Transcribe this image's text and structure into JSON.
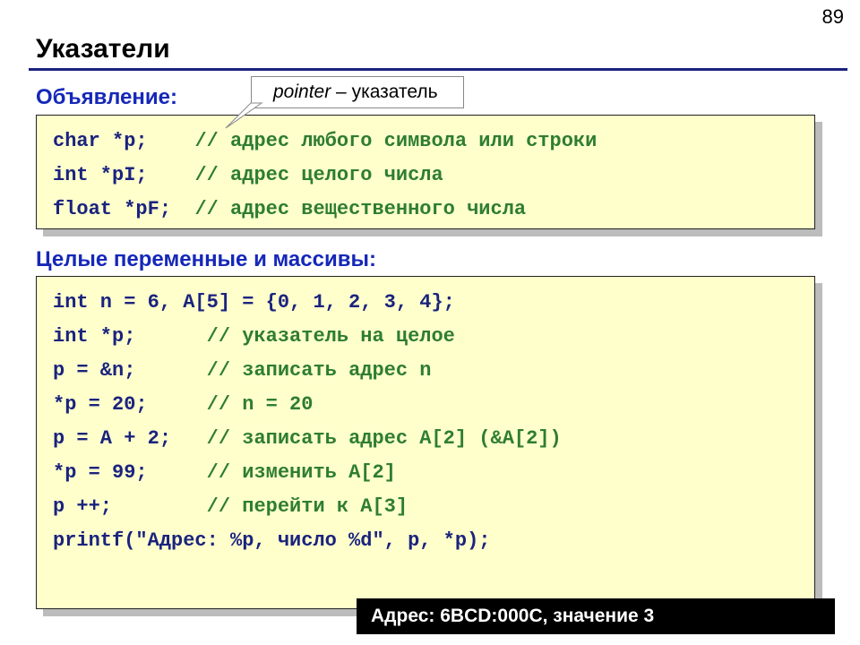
{
  "page_number": "89",
  "title": "Указатели",
  "callout": {
    "italic": "pointer",
    "rest": " – указатель"
  },
  "labels": {
    "declaration": "Объявление:",
    "int_vars": "Целые переменные и массивы:"
  },
  "box1": {
    "l1_code": "char *p;    ",
    "l1_comment": "// адрес любого символа или строки",
    "l2_code": "int *pI;    ",
    "l2_comment": "// адрес целого числа",
    "l3_code": "float *pF;  ",
    "l3_comment": "// адрес вещественного числа"
  },
  "box2": {
    "l1": "int n = 6, A[5] = {0, 1, 2, 3, 4};",
    "l2_code": "int *p;      ",
    "l2_comment": "// указатель на целое",
    "l3_code": "p = &n;      ",
    "l3_comment": "// записать адрес n",
    "l4_code": "*p = 20;     ",
    "l4_comment": "// n = 20",
    "l5_code": "p = A + 2;   ",
    "l5_comment": "// записать адрес A[2] (&A[2])",
    "l6_code": "*p = 99;     ",
    "l6_comment": "// изменить A[2]",
    "l7_code": "p ++;        ",
    "l7_comment": "// перейти к A[3]",
    "l8": "printf(\"Адрес: %p, число %d\", p, *p);"
  },
  "output": "Адрес: 6BCD:000C, значение 3"
}
